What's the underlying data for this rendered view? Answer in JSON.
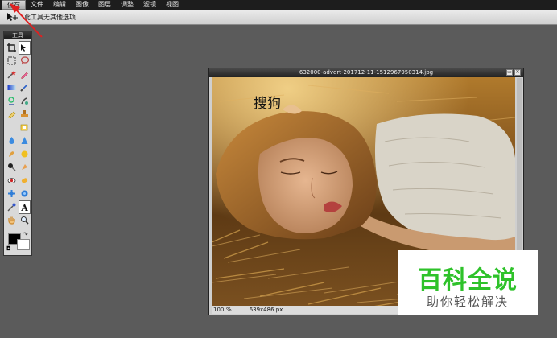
{
  "menubar": {
    "items": [
      "保存",
      "文件",
      "编辑",
      "图像",
      "图层",
      "调整",
      "滤镜",
      "视图"
    ]
  },
  "options_bar": {
    "text": "此工具无其他选项"
  },
  "tools_panel": {
    "title": "工具"
  },
  "document": {
    "title": "632000-advert-201712-11-1512967950314.jpg",
    "zoom": "100",
    "zoom_unit": "%",
    "dimensions": "639x486 px",
    "overlay_text": "搜狗"
  },
  "logo": {
    "main": "百科全说",
    "sub": "助你轻松解决"
  },
  "colors": {
    "annotation_arrow": "#e02020",
    "logo_green": "#2ec22a"
  }
}
